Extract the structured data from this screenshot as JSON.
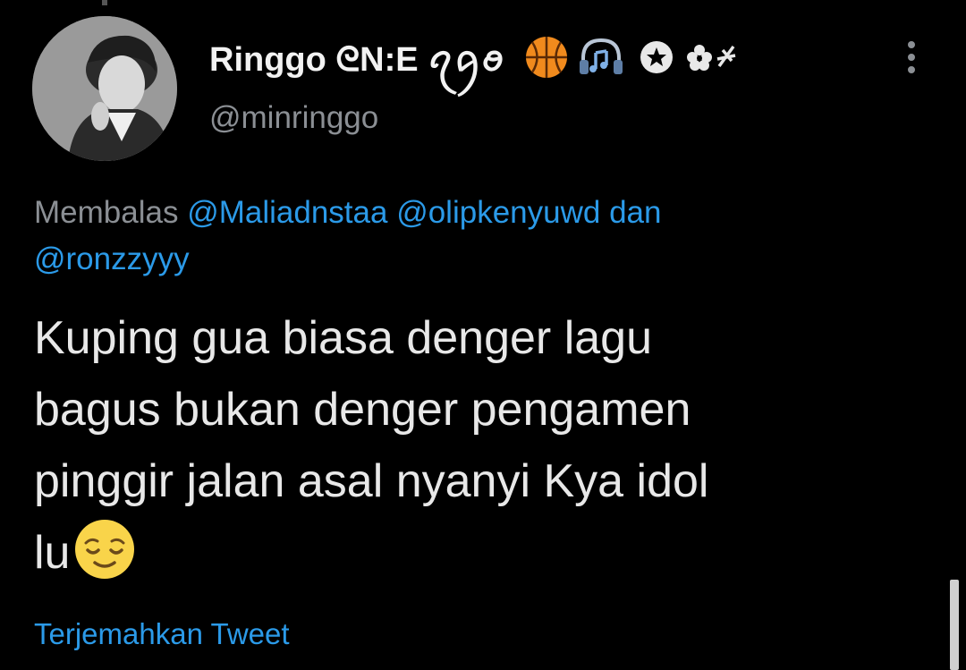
{
  "tweet": {
    "display_name": "Ringgo ᘓN:E ꪖꪇꪮ",
    "handle": "@minringgo",
    "reply": {
      "prefix": "Membalas",
      "mention_1": "@Maliadnstaa",
      "mention_2": "@olipkenyuwd",
      "connector": "dan",
      "mention_3": "@ronzzyyy"
    },
    "text_lines": [
      "Kuping gua biasa denger lagu",
      "bagus bukan denger pengamen",
      "pinggir jalan asal nyanyi Kya idol",
      "lu"
    ],
    "translate_label": "Terjemahkan Tweet"
  },
  "icons": {
    "badge_1": "basketball-icon",
    "badge_2": "headphones-music-icon",
    "badge_3": "star-circle-icon",
    "badge_4": "flower-sparkle-icon",
    "more": "more-vertical-icon",
    "emoji": "relieved-face-emoji"
  },
  "colors": {
    "background": "#000000",
    "text": "#e7e9ea",
    "secondary": "#8b8f94",
    "link": "#2b9ae8"
  }
}
